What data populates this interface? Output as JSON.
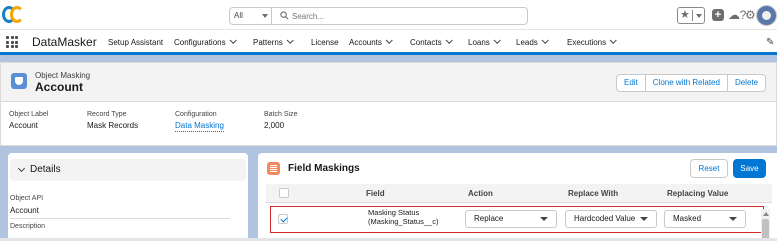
{
  "header": {
    "search_scope": "All",
    "search_placeholder": "Search...",
    "icons": [
      "favorites-star-icon",
      "favorites-dropdown-icon",
      "global-create-icon",
      "trailhead-icon",
      "help-icon",
      "setup-gear-icon",
      "notifications-bell-icon",
      "user-avatar"
    ]
  },
  "nav": {
    "app_name": "DataMasker",
    "items": [
      {
        "label": "Setup Assistant",
        "has_menu": false
      },
      {
        "label": "Configurations",
        "has_menu": true
      },
      {
        "label": "Patterns",
        "has_menu": true
      },
      {
        "label": "License",
        "has_menu": false
      },
      {
        "label": "Accounts",
        "has_menu": true
      },
      {
        "label": "Contacts",
        "has_menu": true
      },
      {
        "label": "Loans",
        "has_menu": true
      },
      {
        "label": "Leads",
        "has_menu": true
      },
      {
        "label": "Executions",
        "has_menu": true
      }
    ]
  },
  "record": {
    "object_type": "Object Masking",
    "name": "Account",
    "actions": [
      "Edit",
      "Clone with Related",
      "Delete"
    ]
  },
  "highlights": [
    {
      "label": "Object Label",
      "value": "Account",
      "link": false
    },
    {
      "label": "Record Type",
      "value": "Mask Records",
      "link": false
    },
    {
      "label": "Configuration",
      "value": "Data Masking",
      "link": true
    },
    {
      "label": "Batch Size",
      "value": "2,000",
      "link": false
    }
  ],
  "details": {
    "title": "Details",
    "fields": [
      {
        "label": "Object API",
        "value": "Account"
      },
      {
        "label": "Description",
        "value": ""
      }
    ]
  },
  "field_maskings": {
    "title": "Field Maskings",
    "reset_label": "Reset",
    "save_label": "Save",
    "columns": [
      "Field",
      "Action",
      "Replace With",
      "Replacing Value"
    ],
    "rows": [
      {
        "checked": true,
        "field_line1": "Masking Status",
        "field_line2": "(Masking_Status__c)",
        "action": "Replace",
        "replace_with": "Hardcoded Value",
        "replacing_value": "Masked"
      }
    ]
  }
}
